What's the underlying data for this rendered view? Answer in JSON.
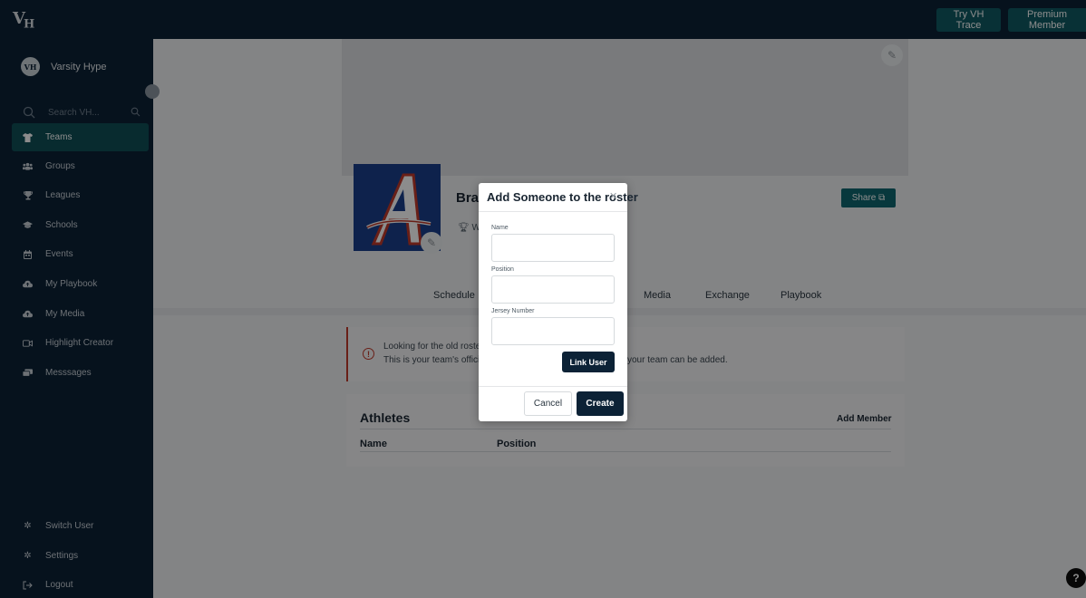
{
  "topbar": {
    "logo": "VH",
    "try_trace": "Try VH Trace",
    "premium": "Premium Member"
  },
  "sidebar": {
    "brand": "Varsity Hype",
    "search_placeholder": "Search VH...",
    "items": [
      {
        "label": "Teams",
        "icon": "jersey-icon",
        "active": true
      },
      {
        "label": "Groups",
        "icon": "users-icon"
      },
      {
        "label": "Leagues",
        "icon": "trophy-icon"
      },
      {
        "label": "Schools",
        "icon": "graduation-cap-icon"
      },
      {
        "label": "Events",
        "icon": "calendar-icon"
      },
      {
        "label": "My Playbook",
        "icon": "cloud-upload-icon"
      },
      {
        "label": "My Media",
        "icon": "cloud-upload-icon"
      },
      {
        "label": "Highlight Creator",
        "icon": "video-camera-icon"
      },
      {
        "label": "Messsages",
        "icon": "chat-icon"
      }
    ],
    "bottom": [
      {
        "label": "Switch User",
        "icon": "gear-icon"
      },
      {
        "label": "Settings",
        "icon": "gear-icon"
      },
      {
        "label": "Logout",
        "icon": "logout-icon"
      }
    ]
  },
  "team": {
    "name": "Brav",
    "sub": "W",
    "share": "Share"
  },
  "tabs": [
    "Schedule",
    "Media",
    "Exchange",
    "Playbook"
  ],
  "alert": {
    "line1": "Looking for the old roste",
    "line2": "This is your team's offici",
    "line2_tail": "your team can be added."
  },
  "athletes": {
    "title": "Athletes",
    "add_member": "Add Member",
    "columns": [
      "Name",
      "Position"
    ]
  },
  "modal": {
    "title": "Add Someone to the roster",
    "fields": [
      {
        "label": "Name",
        "value": ""
      },
      {
        "label": "Position",
        "value": ""
      },
      {
        "label": "Jersey Number",
        "value": ""
      }
    ],
    "link_user": "Link User",
    "cancel": "Cancel",
    "create": "Create"
  },
  "help": "?"
}
